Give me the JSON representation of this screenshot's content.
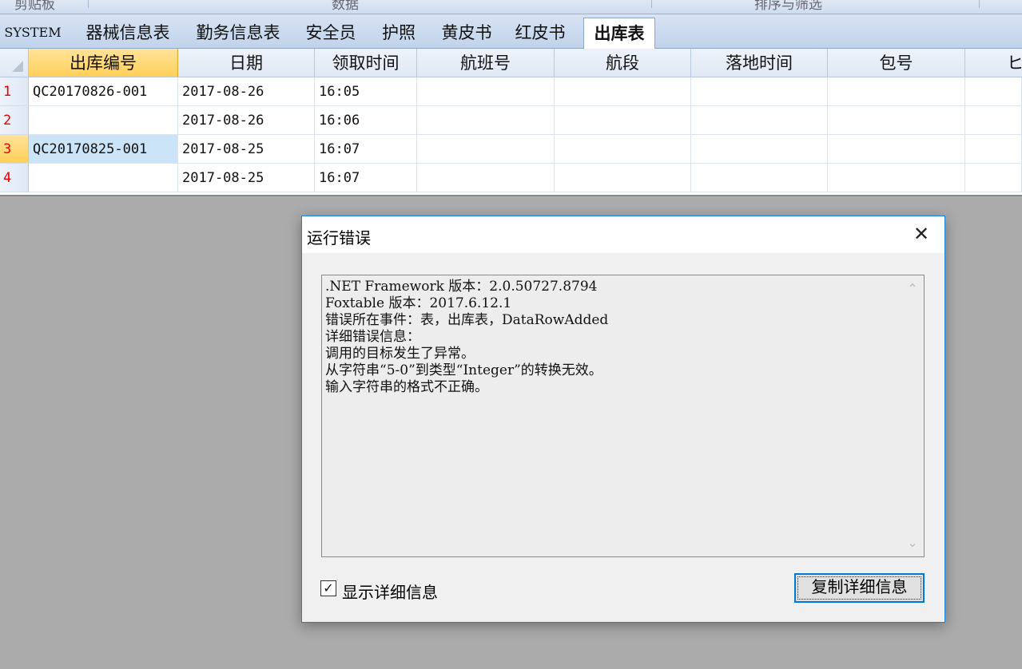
{
  "ribbon": {
    "groups": [
      "剪贴板",
      "数据",
      "排序与筛选"
    ]
  },
  "tabs": [
    {
      "label": "SYSTEM",
      "active": false
    },
    {
      "label": "器械信息表",
      "active": false
    },
    {
      "label": "勤务信息表",
      "active": false
    },
    {
      "label": "安全员",
      "active": false
    },
    {
      "label": "护照",
      "active": false
    },
    {
      "label": "黄皮书",
      "active": false
    },
    {
      "label": "红皮书",
      "active": false
    },
    {
      "label": "出库表",
      "active": true
    }
  ],
  "grid": {
    "columns": [
      "出库编号",
      "日期",
      "领取时间",
      "航班号",
      "航段",
      "落地时间",
      "包号",
      "ヒ"
    ],
    "selected_column": "出库编号",
    "rows": [
      {
        "num": "1",
        "cells": [
          "QC20170826-001",
          "2017-08-26",
          "16:05",
          "",
          "",
          "",
          "",
          ""
        ]
      },
      {
        "num": "2",
        "cells": [
          "",
          "2017-08-26",
          "16:06",
          "",
          "",
          "",
          "",
          ""
        ]
      },
      {
        "num": "3",
        "cells": [
          "QC20170825-001",
          "2017-08-25",
          "16:07",
          "",
          "",
          "",
          "",
          ""
        ]
      },
      {
        "num": "4",
        "cells": [
          "",
          "2017-08-25",
          "16:07",
          "",
          "",
          "",
          "",
          ""
        ]
      }
    ],
    "selected_row": "3"
  },
  "dialog": {
    "title": "运行错误",
    "close_glyph": "✕",
    "message_lines": [
      ".NET Framework 版本：2.0.50727.8794",
      "Foxtable 版本：2017.6.12.1",
      "错误所在事件：表，出库表，DataRowAdded",
      "详细错误信息：",
      "调用的目标发生了异常。",
      "从字符串“5-0”到类型“Integer”的转换无效。",
      "输入字符串的格式不正确。"
    ],
    "show_details_label": "显示详细信息",
    "show_details_checked": true,
    "copy_button_label": "复制详细信息"
  },
  "colors": {
    "accent": "#0078d7",
    "selected_header": "#ffcf58",
    "selected_cell": "#cce4f7",
    "row_number": "#e00000"
  }
}
